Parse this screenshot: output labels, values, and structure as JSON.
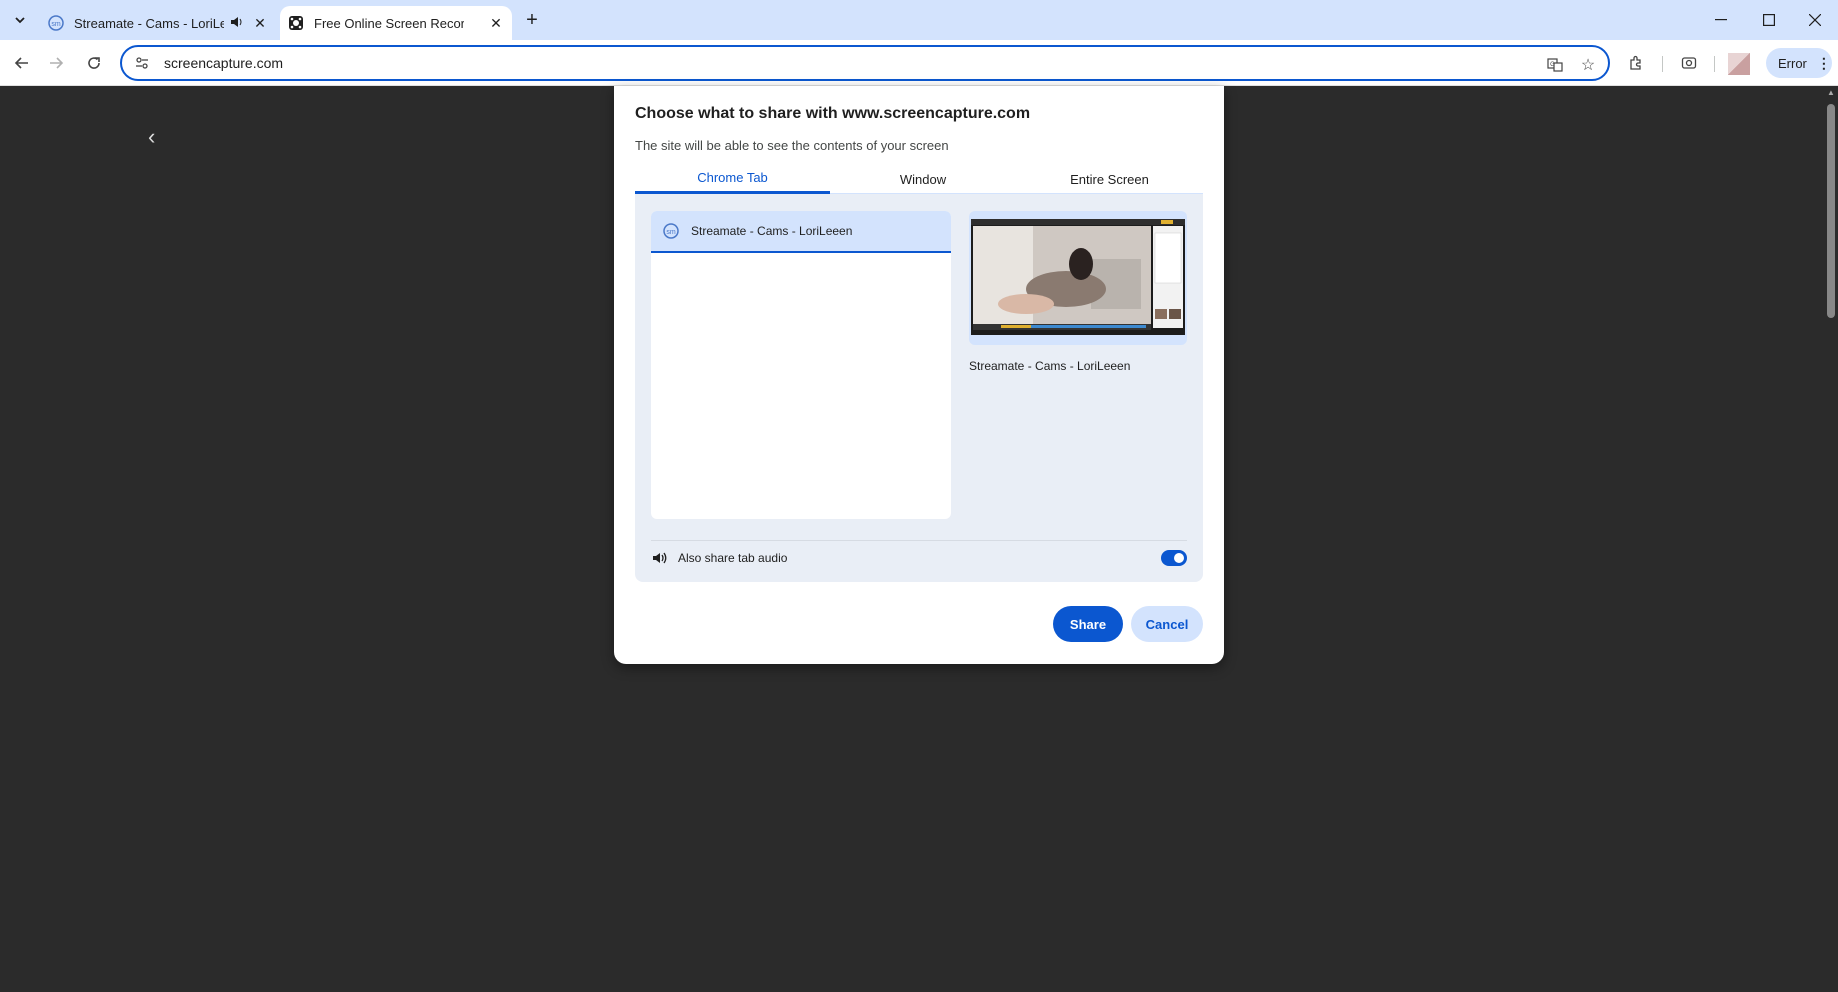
{
  "browser": {
    "tabs": [
      {
        "title": "Streamate - Cams - LoriLeen",
        "icon": "streamate-icon",
        "audio": true
      },
      {
        "title": "Free Online Screen Recorder | C",
        "icon": "screencapture-icon",
        "active": true
      }
    ],
    "url": "screencapture.com",
    "profile_status": "Error"
  },
  "dialog": {
    "title": "Choose what to share with www.screencapture.com",
    "subtitle": "The site will be able to see the contents of your screen",
    "tabs": [
      {
        "label": "Chrome Tab",
        "active": true
      },
      {
        "label": "Window"
      },
      {
        "label": "Entire Screen"
      }
    ],
    "tab_list": [
      {
        "title": "Streamate - Cams - LoriLeeen",
        "selected": true
      }
    ],
    "preview_label": "Streamate - Cams - LoriLeeen",
    "audio_label": "Also share tab audio",
    "audio_enabled": true,
    "share_label": "Share",
    "cancel_label": "Cancel"
  },
  "colors": {
    "accent": "#0b57d0",
    "tabstrip": "#d3e3fd",
    "page_bg": "#2b2b2b"
  }
}
